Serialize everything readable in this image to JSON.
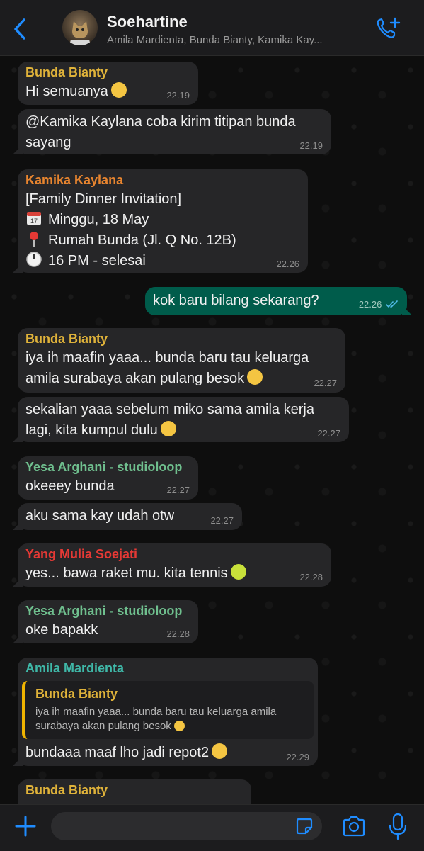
{
  "header": {
    "title": "Soehartine",
    "subtitle": "Amila Mardienta, Bunda Bianty, Kamika Kay...",
    "back_icon": "chevron-left-icon",
    "call_icon": "add-call-icon",
    "accent": "#1f8cff"
  },
  "messages": [
    {
      "sender": "Bunda Bianty",
      "sender_color": "#e0b33a",
      "lines": [
        "Hi semuanya"
      ],
      "emoji": "hugging-face",
      "time": "22.19"
    },
    {
      "lines": [
        "@Kamika Kaylana coba kirim titipan bunda",
        "sayang"
      ],
      "time": "22.19"
    },
    {
      "sender": "Kamika Kaylana",
      "sender_color": "#e8852f",
      "lines": [
        "[Family Dinner Invitation]",
        "Minggu, 18 May",
        "Rumah Bunda (Jl. Q No. 12B)",
        "16 PM - selesai"
      ],
      "icons": [
        "calendar-icon",
        "pin-icon",
        "clock-icon"
      ],
      "time": "22.26"
    },
    {
      "outgoing": true,
      "lines": [
        "kok baru bilang sekarang?"
      ],
      "time": "22.26",
      "status_icon": "double-check-icon"
    },
    {
      "sender": "Bunda Bianty",
      "sender_color": "#e0b33a",
      "lines": [
        "iya ih maafin yaaa... bunda baru tau keluarga",
        "amila surabaya akan pulang besok"
      ],
      "emoji": "pleading-face",
      "time": "22.27"
    },
    {
      "lines": [
        "sekalian yaaa sebelum miko sama amila kerja",
        "lagi, kita kumpul dulu"
      ],
      "emoji": "hugging-face",
      "time": "22.27"
    },
    {
      "sender": "Yesa Arghani - studioloop",
      "sender_color": "#6fbf8e",
      "lines": [
        "okeeey bunda"
      ],
      "time": "22.27"
    },
    {
      "lines": [
        "aku sama kay udah otw"
      ],
      "time": "22.27"
    },
    {
      "sender": "Yang Mulia Soejati",
      "sender_color": "#e53935",
      "lines": [
        "yes... bawa raket mu. kita tennis"
      ],
      "emoji": "tennis-ball",
      "time": "22.28"
    },
    {
      "sender": "Yesa Arghani - studioloop",
      "sender_color": "#6fbf8e",
      "lines": [
        "oke bapakk"
      ],
      "time": "22.28"
    },
    {
      "sender": "Amila Mardienta",
      "sender_color": "#3fb8a8",
      "quote": {
        "sender": "Bunda Bianty",
        "lines": [
          "iya ih maafin yaaa... bunda baru tau keluarga amila",
          "surabaya akan pulang besok"
        ]
      },
      "lines": [
        "bundaaa maaf lho jadi repot2"
      ],
      "emoji": "crying-face",
      "time": "22.29"
    },
    {
      "sender": "Bunda Bianty",
      "sender_color": "#e0b33a",
      "lines": [],
      "time": ""
    }
  ],
  "footer": {
    "plus_icon": "plus-icon",
    "input_value": "",
    "input_placeholder": "",
    "sticker_icon": "sticker-icon",
    "camera_icon": "camera-icon",
    "mic_icon": "microphone-icon"
  }
}
